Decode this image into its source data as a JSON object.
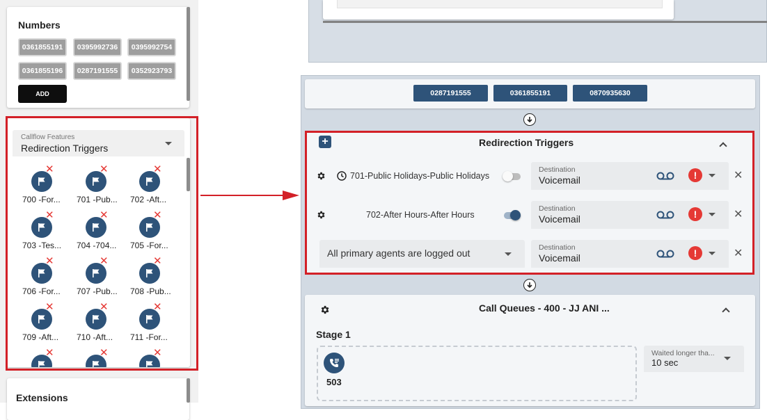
{
  "numbers_card": {
    "title": "Numbers",
    "numbers": [
      "0361855191",
      "0395992736",
      "0395992754",
      "0361855196",
      "0287191555",
      "0352923793"
    ],
    "add_label": "ADD"
  },
  "features_card": {
    "select_label": "Callflow Features",
    "select_value": "Redirection Triggers",
    "items": [
      "700 -For...",
      "701 -Pub...",
      "702 -Aft...",
      "703 -Tes...",
      "704 -704...",
      "705 -For...",
      "706 -For...",
      "707 -Pub...",
      "708 -Pub...",
      "709 -Aft...",
      "710 -Aft...",
      "711 -For..."
    ]
  },
  "extensions_card": {
    "title": "Extensions"
  },
  "flow": {
    "numbers": [
      "0287191555",
      "0361855191",
      "0870935630"
    ],
    "redirection": {
      "title": "Redirection Triggers",
      "triggers": [
        {
          "label": "701-Public Holidays-Public Holidays",
          "enabled": false,
          "dest_label": "Destination",
          "dest_value": "Voicemail"
        },
        {
          "label": "702-After Hours-After Hours",
          "enabled": true,
          "dest_label": "Destination",
          "dest_value": "Voicemail"
        },
        {
          "condition": "All primary agents are logged out",
          "dest_label": "Destination",
          "dest_value": "Voicemail"
        }
      ]
    },
    "queues": {
      "title": "Call Queues - 400 - JJ ANI ...",
      "stage_label": "Stage 1",
      "queue_number": "503",
      "wait_label": "Waited longer tha...",
      "wait_value": "10 sec"
    }
  },
  "colors": {
    "primary": "#2e5379",
    "highlight": "#d32027",
    "warning": "#e53935"
  }
}
